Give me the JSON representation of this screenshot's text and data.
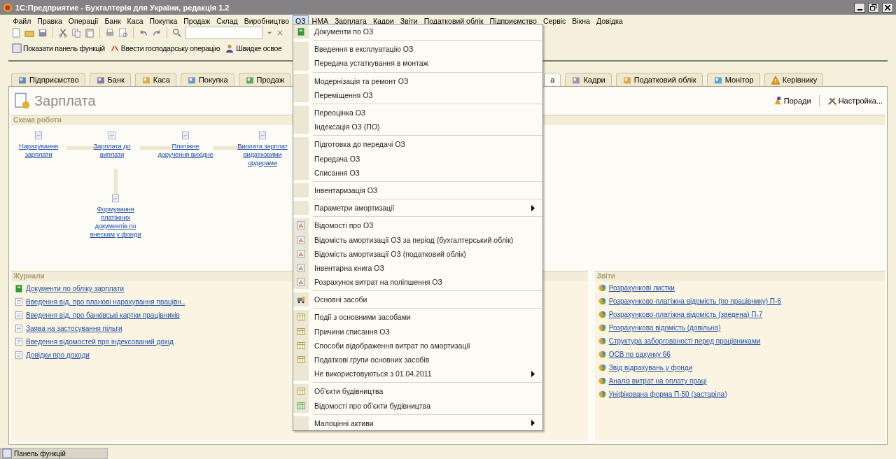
{
  "window": {
    "title": "1С:Предприятие - Бухгалтерія для України, редакція 1.2"
  },
  "menu_bar": [
    {
      "label": "Файл",
      "selected": false
    },
    {
      "label": "Правка",
      "selected": false
    },
    {
      "label": "Операції",
      "selected": false
    },
    {
      "label": "Банк",
      "selected": false
    },
    {
      "label": "Каса",
      "selected": false
    },
    {
      "label": "Покупка",
      "selected": false
    },
    {
      "label": "Продаж",
      "selected": false
    },
    {
      "label": "Склад",
      "selected": false
    },
    {
      "label": "Виробництво",
      "selected": false
    },
    {
      "label": "ОЗ",
      "selected": true
    },
    {
      "label": "НМА",
      "selected": false
    },
    {
      "label": "Зарплата",
      "selected": false
    },
    {
      "label": "Кадри",
      "selected": false
    },
    {
      "label": "Звіти",
      "selected": false
    },
    {
      "label": "Податковий облік",
      "selected": false
    },
    {
      "label": "Підприємство",
      "selected": false
    },
    {
      "label": "Сервіс",
      "selected": false
    },
    {
      "label": "Вікна",
      "selected": false
    },
    {
      "label": "Довідка",
      "selected": false
    }
  ],
  "function_bar": [
    "Показати панель функцій",
    "Ввести господарську операцію",
    "Швидке освое"
  ],
  "tabs": [
    {
      "label": "Підприємство",
      "selected": false
    },
    {
      "label": "Банк",
      "selected": false
    },
    {
      "label": "Каса",
      "selected": false
    },
    {
      "label": "Покупка",
      "selected": false
    },
    {
      "label": "Продаж",
      "selected": false
    },
    {
      "label": "а",
      "selected": true
    },
    {
      "label": "Кадри",
      "selected": false
    },
    {
      "label": "Податковий облік",
      "selected": false
    },
    {
      "label": "Монітор",
      "selected": false
    },
    {
      "label": "Керівнику",
      "selected": false
    }
  ],
  "section": {
    "title": "Зарплата",
    "actions": [
      "Поради",
      "Настройка..."
    ]
  },
  "scheme": {
    "title": "Схема роботи",
    "nodes": [
      "Нарахування зарплати",
      "Зарплата до виплати",
      "Платіжне доручення вихідне",
      "Виплата зарплат видатковими ордерами",
      "Формування платіжних документів по внескам у фонди"
    ]
  },
  "journals": {
    "title": "Журнали",
    "items": [
      {
        "label": "Документи по обліку зарплати",
        "kind": "journal"
      },
      {
        "label": "Введення від. про планові нарахування працівн..",
        "kind": "document"
      },
      {
        "label": "Введення від. про банківські картки працівників",
        "kind": "document"
      },
      {
        "label": "Заява на застосування пільги",
        "kind": "document"
      },
      {
        "label": "Введення відомостей про індексований дохід",
        "kind": "document"
      },
      {
        "label": "Довідки про доходи",
        "kind": "document"
      }
    ]
  },
  "reports": {
    "title": "Звіти",
    "items": [
      "Розрахункові листки",
      "Розрахунково-платіжна відомість (по працівнику) П-6",
      "Розрахунково-платіжна відомість (зведена) П-7",
      "Розрахункова відомість (довільна)",
      "Структура заборгованості перед працівниками",
      "ОСВ по рахунку 66",
      "Звід відрахувань у фонди",
      "Аналіз витрат на оплату праці",
      "Уніфікована форма П-50 (застаріла)"
    ]
  },
  "menu": {
    "groups": [
      [
        {
          "label": "Документи по ОЗ",
          "kind": "journal",
          "submenu": false
        }
      ],
      [
        {
          "label": "Введення в експлуатацію ОЗ",
          "kind": "command",
          "submenu": false
        },
        {
          "label": "Передача устаткування в монтаж",
          "kind": "command",
          "submenu": false
        }
      ],
      [
        {
          "label": "Модернізація та ремонт ОЗ",
          "kind": "command",
          "submenu": false
        },
        {
          "label": "Переміщення ОЗ",
          "kind": "command",
          "submenu": false
        }
      ],
      [
        {
          "label": "Переоцінка ОЗ",
          "kind": "command",
          "submenu": false
        },
        {
          "label": "Індексація ОЗ (ПО)",
          "kind": "command",
          "submenu": false
        }
      ],
      [
        {
          "label": "Підготовка до передачі ОЗ",
          "kind": "command",
          "submenu": false
        },
        {
          "label": "Передача ОЗ",
          "kind": "command",
          "submenu": false
        },
        {
          "label": "Списання ОЗ",
          "kind": "command",
          "submenu": false
        }
      ],
      [
        {
          "label": "Інвентаризація ОЗ",
          "kind": "command",
          "submenu": false
        }
      ],
      [
        {
          "label": "Параметри амортизації",
          "kind": "command",
          "submenu": true
        }
      ],
      [
        {
          "label": "Відомості про ОЗ",
          "kind": "report",
          "submenu": false
        },
        {
          "label": "Відомість амортизації ОЗ за період (бухгалтерський облік)",
          "kind": "report",
          "submenu": false
        },
        {
          "label": "Відомість амортизації ОЗ  (податковий облік)",
          "kind": "report",
          "submenu": false
        },
        {
          "label": "Інвентарна книга ОЗ",
          "kind": "report",
          "submenu": false
        },
        {
          "label": "Розрахунок витрат на поліпшення ОЗ",
          "kind": "report",
          "submenu": false
        }
      ],
      [
        {
          "label": "Основні засоби",
          "kind": "catalog",
          "submenu": false
        }
      ],
      [
        {
          "label": "Події з основними засобами",
          "kind": "table",
          "submenu": false
        },
        {
          "label": "Причини списання ОЗ",
          "kind": "table",
          "submenu": false
        },
        {
          "label": "Способи відображення витрат по амортизації",
          "kind": "table",
          "submenu": false
        },
        {
          "label": "Податкові групи основних засобів",
          "kind": "table",
          "submenu": false
        },
        {
          "label": "Не використовуються з 01.04.2011",
          "kind": "command",
          "submenu": true
        }
      ],
      [
        {
          "label": "Об'єкти будівництва",
          "kind": "table",
          "submenu": false
        },
        {
          "label": "Відомості про об'єкти будівництва",
          "kind": "register",
          "submenu": false
        }
      ],
      [
        {
          "label": "Малоцінні активи",
          "kind": "command",
          "submenu": true
        }
      ]
    ]
  },
  "status_bar": {
    "button": "Панель функцій"
  }
}
